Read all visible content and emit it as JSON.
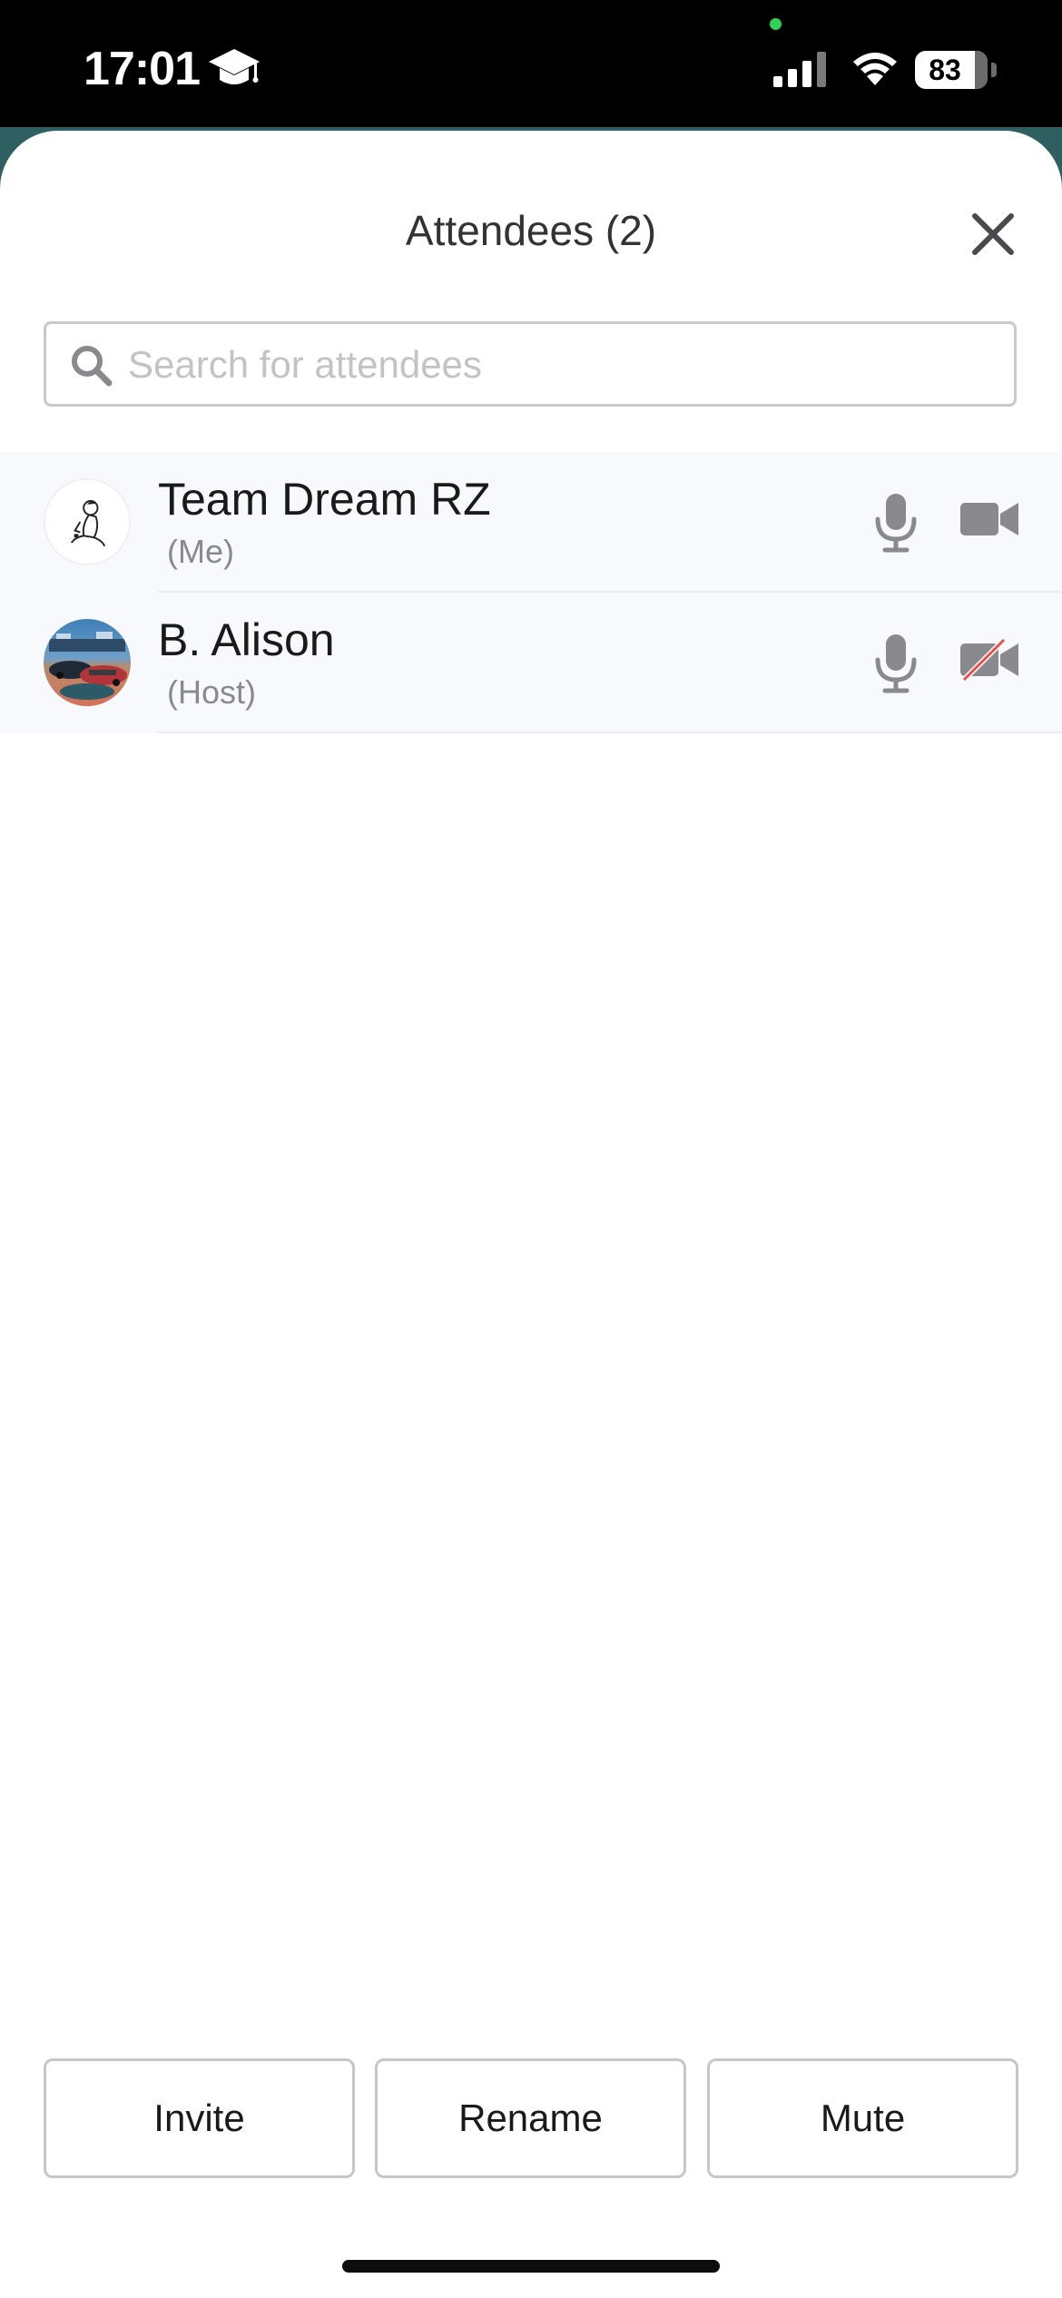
{
  "status_bar": {
    "time": "17:01",
    "battery_level": 83,
    "battery_text": "83"
  },
  "header": {
    "title": "Attendees (2)"
  },
  "search": {
    "placeholder": "Search for attendees",
    "value": ""
  },
  "attendees": [
    {
      "name": "Team Dream RZ",
      "role": "(Me)",
      "mic": "on",
      "camera": "on"
    },
    {
      "name": "B. Alison",
      "role": "(Host)",
      "mic": "on",
      "camera": "off"
    }
  ],
  "actions": {
    "invite_label": "Invite",
    "rename_label": "Rename",
    "mute_label": "Mute"
  },
  "colors": {
    "backdrop": "#2f5f61",
    "icon_gray": "#8a8a8e",
    "camera_off_slash": "#e8504b",
    "row_background": "#f8f9fc"
  }
}
